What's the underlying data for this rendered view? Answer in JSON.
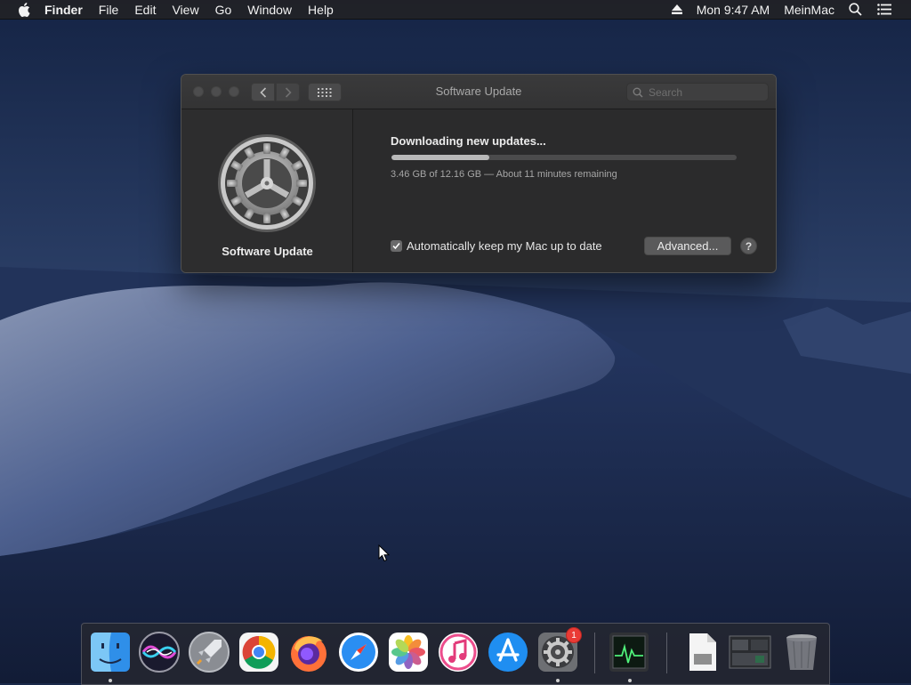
{
  "menubar": {
    "app_name": "Finder",
    "items": [
      "File",
      "Edit",
      "View",
      "Go",
      "Window",
      "Help"
    ],
    "clock": "Mon 9:47 AM",
    "user": "MeinMac"
  },
  "window": {
    "title": "Software Update",
    "search_placeholder": "Search",
    "pane_label": "Software Update",
    "status_title": "Downloading new updates...",
    "progress": 0.2845,
    "status_detail": "3.46 GB of 12.16 GB — About 11 minutes remaining",
    "auto_update_label": "Automatically keep my Mac up to date",
    "auto_update_checked": true,
    "advanced_label": "Advanced...",
    "help_label": "?"
  },
  "dock": {
    "apps": [
      "Finder",
      "Siri",
      "Launchpad",
      "Google Chrome",
      "Firefox",
      "Safari",
      "Photos",
      "iTunes",
      "App Store",
      "System Preferences",
      "Activity Monitor",
      "Document",
      "Screen Capture",
      "Trash"
    ],
    "system_preferences_badge": "1"
  },
  "colors": {
    "window_bg": "#2b2b2c",
    "menubar_bg": "#222226",
    "badge_red": "#ea3b35",
    "progress_fill": "#b9b9b9"
  }
}
